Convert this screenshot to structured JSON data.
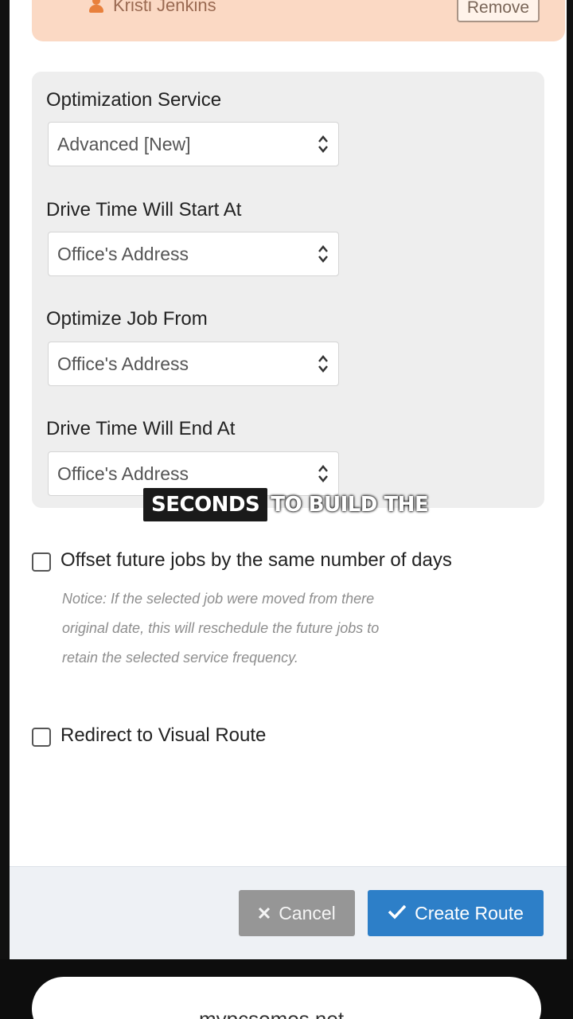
{
  "assignee": {
    "name": "Kristi Jenkins",
    "remove_label": "Remove"
  },
  "settings": {
    "optimization_service": {
      "label": "Optimization Service",
      "value": "Advanced [New]"
    },
    "drive_start": {
      "label": "Drive Time Will Start At",
      "value": "Office's Address"
    },
    "optimize_from": {
      "label": "Optimize Job From",
      "value": "Office's Address"
    },
    "drive_end": {
      "label": "Drive Time Will End At",
      "value": "Office's Address"
    }
  },
  "options": {
    "offset_label": "Offset future jobs by the same number of days",
    "offset_notice": "Notice: If the selected job were moved from there original date, this will reschedule the future jobs to retain the selected service frequency.",
    "redirect_label": "Redirect to Visual Route"
  },
  "caption": {
    "highlight": "SECONDS",
    "rest": "TO BUILD THE"
  },
  "footer": {
    "cancel_label": "Cancel",
    "create_label": "Create Route"
  },
  "browser": {
    "url": "mypcsomos.net"
  },
  "colors": {
    "assignee_bg": "#fbd9c4",
    "primary": "#2d7fc8",
    "cancel": "#969696"
  }
}
